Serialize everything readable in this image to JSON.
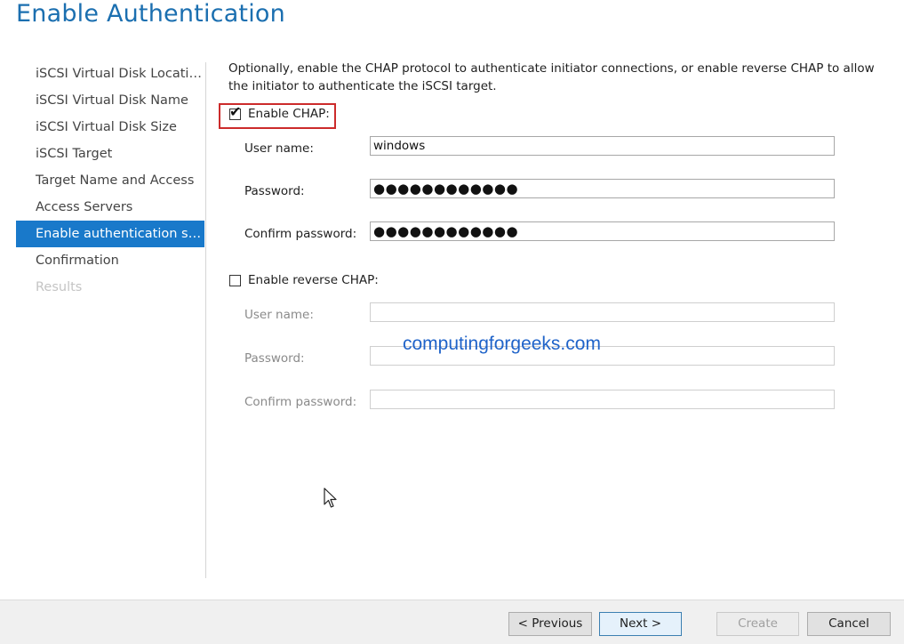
{
  "page": {
    "title": "Enable Authentication"
  },
  "nav": {
    "items": [
      {
        "label": "iSCSI Virtual Disk Location",
        "state": "normal"
      },
      {
        "label": "iSCSI Virtual Disk Name",
        "state": "normal"
      },
      {
        "label": "iSCSI Virtual Disk Size",
        "state": "normal"
      },
      {
        "label": "iSCSI Target",
        "state": "normal"
      },
      {
        "label": "Target Name and Access",
        "state": "normal"
      },
      {
        "label": "Access Servers",
        "state": "normal"
      },
      {
        "label": "Enable authentication ser...",
        "state": "active"
      },
      {
        "label": "Confirmation",
        "state": "normal"
      },
      {
        "label": "Results",
        "state": "disabled"
      }
    ]
  },
  "main": {
    "description": "Optionally, enable the CHAP protocol to authenticate initiator connections, or enable reverse CHAP to allow the initiator to authenticate the iSCSI target.",
    "chap": {
      "checkbox_label": "Enable CHAP:",
      "checked": true,
      "user_name_label": "User name:",
      "user_name_value": "windows",
      "password_label": "Password:",
      "password_value": "●●●●●●●●●●●●",
      "confirm_label": "Confirm password:",
      "confirm_value": "●●●●●●●●●●●●"
    },
    "reverse_chap": {
      "checkbox_label": "Enable reverse CHAP:",
      "checked": false,
      "user_name_label": "User name:",
      "user_name_value": "",
      "password_label": "Password:",
      "password_value": "",
      "confirm_label": "Confirm password:",
      "confirm_value": ""
    },
    "watermark": "computingforgeeks.com"
  },
  "footer": {
    "previous_label": "< Previous",
    "next_label": "Next >",
    "create_label": "Create",
    "cancel_label": "Cancel"
  },
  "colors": {
    "title": "#1b6fb0",
    "active_nav": "#1979ca",
    "highlight_box": "#cc2b2b",
    "watermark": "#1f63c9"
  },
  "icons": {
    "checkmark": "checkmark-icon",
    "cursor": "mouse-pointer-icon"
  }
}
